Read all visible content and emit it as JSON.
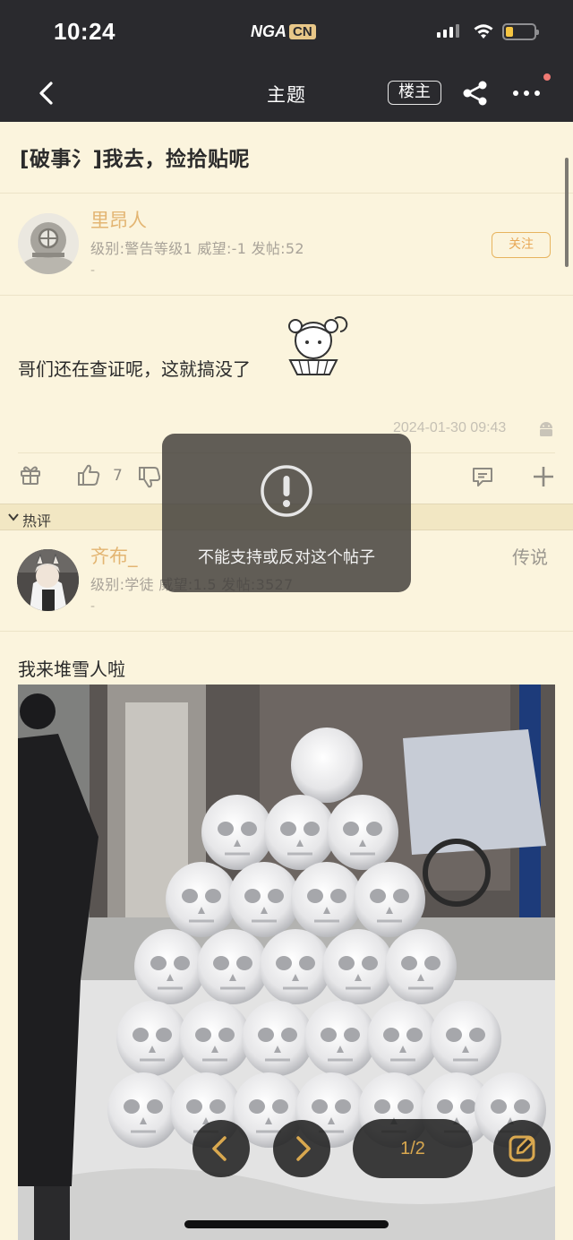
{
  "status_bar": {
    "time": "10:24",
    "logo_main": "NGA",
    "logo_suffix": "CN",
    "signal_icon": "cellular-signal-icon",
    "wifi_icon": "wifi-icon",
    "battery_level": 0.25,
    "battery_color": "#f5c542"
  },
  "header": {
    "back_icon": "chevron-left-icon",
    "title": "主题",
    "louzhu_label": "楼主",
    "share_icon": "share-icon",
    "more_icon": "more-dots-icon",
    "notification_dot_color": "#f07a74"
  },
  "post": {
    "title": "[破事氵]我去，捡拾贴呢",
    "author": {
      "name": "里昂人",
      "meta": "级别:警告等级1  威望:-1  发帖:52",
      "sign": "-",
      "follow_label": "关注"
    },
    "body": "哥们还在查证呢，这就搞没了",
    "timestamp": "2024-01-30 09:43",
    "device_icon": "android-icon",
    "actions": {
      "gift_icon": "gift-icon",
      "like_icon": "thumbs-up-icon",
      "like_count": "7",
      "dislike_icon": "thumbs-down-icon",
      "comment_icon": "comment-icon",
      "add_icon": "plus-icon"
    }
  },
  "hot_section": {
    "label": "热评",
    "comment": {
      "name": "齐布_",
      "meta": "级别:学徒  威望:1.5  发帖:3527",
      "sign": "-",
      "rank": "传说",
      "text": "我来堆雪人啦"
    }
  },
  "toast": {
    "icon": "exclamation-circle-icon",
    "message": "不能支持或反对这个帖子"
  },
  "image_viewer": {
    "prev_icon": "chevron-left-icon",
    "next_icon": "chevron-right-icon",
    "page_indicator": "1/2",
    "edit_icon": "edit-icon"
  },
  "colors": {
    "background": "#fbf4dd",
    "header": "#2a2a2e",
    "accent": "#e3b572"
  }
}
